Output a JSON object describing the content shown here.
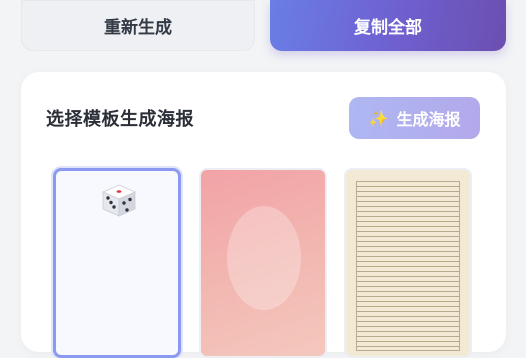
{
  "actions": {
    "regenerate_label": "重新生成",
    "copy_all_label": "复制全部"
  },
  "template_panel": {
    "title": "选择模板生成海报",
    "generate_label": "生成海报",
    "generate_icon": "sparkles-icon",
    "templates": [
      {
        "name": "dice-template",
        "icon": "dice-icon",
        "selected": true
      },
      {
        "name": "pink-gradient-template",
        "selected": false
      },
      {
        "name": "lined-paper-template",
        "selected": false
      }
    ]
  },
  "colors": {
    "accent_start": "#6a7ee6",
    "accent_end": "#6b4fb0",
    "selected_border": "#8b9af0",
    "pink": "#f2a2a6",
    "paper": "#f2ead5"
  }
}
